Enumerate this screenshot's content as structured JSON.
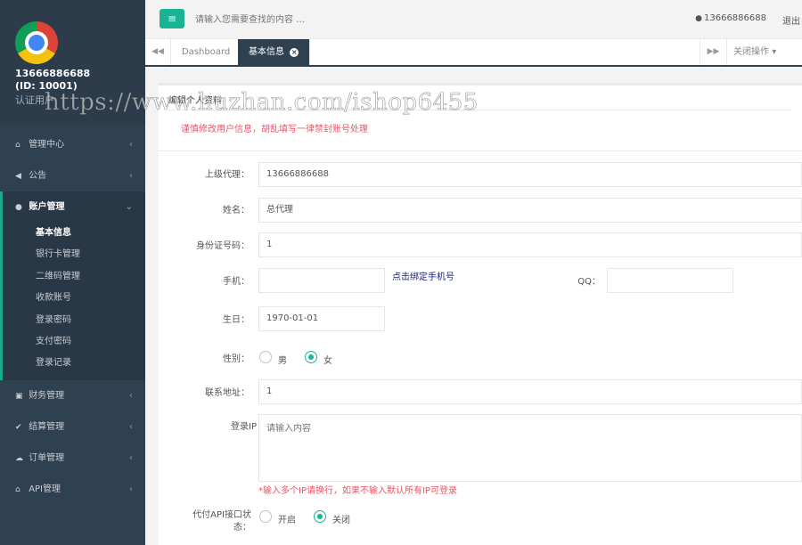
{
  "sidebar": {
    "profile": {
      "name": "13666886688",
      "id_line": "(ID:  10001)",
      "role": "认证用户"
    },
    "menu": [
      {
        "label": "管理中心",
        "icon": "home-icon"
      },
      {
        "label": "公告",
        "icon": "volume-icon"
      }
    ],
    "account": {
      "label": "账户管理",
      "icon": "user-icon",
      "items": [
        "基本信息",
        "银行卡管理",
        "二维码管理",
        "收款账号",
        "登录密码",
        "支付密码",
        "登录记录"
      ]
    },
    "menu_bottom": [
      {
        "label": "财务管理",
        "icon": "money-icon"
      },
      {
        "label": "结算管理",
        "icon": "check-icon"
      },
      {
        "label": "订单管理",
        "icon": "cloud-icon"
      },
      {
        "label": "API管理",
        "icon": "bank-icon"
      }
    ]
  },
  "topbar": {
    "search_placeholder": "请输入您需要查找的内容 …",
    "user": "13666886688",
    "logout": "退出"
  },
  "tabs": {
    "items": [
      {
        "label": "Dashboard"
      },
      {
        "label": "基本信息"
      }
    ],
    "close_ops": "关闭操作"
  },
  "panel": {
    "title": "编辑个人资料",
    "notice": "谨慎修改用户信息，胡乱填写一律禁封账号处理"
  },
  "form": {
    "parent_agent": {
      "label": "上级代理：",
      "value": "13666886688"
    },
    "name": {
      "label": "姓名：",
      "value": "总代理"
    },
    "id_number": {
      "label": "身份证号码：",
      "value": "1"
    },
    "phone": {
      "label": "手机：",
      "value": "",
      "bind_link": "点击绑定手机号"
    },
    "qq": {
      "label": "QQ：",
      "value": ""
    },
    "birthday": {
      "label": "生日：",
      "value": "1970-01-01"
    },
    "gender": {
      "label": "性别：",
      "options": [
        "男",
        "女"
      ],
      "selected": "女"
    },
    "address": {
      "label": "联系地址：",
      "value": "1"
    },
    "login_ip": {
      "label": "登录IP",
      "placeholder": "请输入内容",
      "hint": "*输入多个IP请换行，如果不输入默认所有IP可登录"
    },
    "api_status": {
      "label_line1": "代付API接口状",
      "label_line2": "态：",
      "options": [
        "开启",
        "关闭"
      ],
      "selected": "关闭"
    }
  },
  "watermark": "https://www.huzhan.com/ishop6455",
  "colors": {
    "accent": "#1ab394",
    "sidebar": "#2f4050",
    "warning": "#ed5565",
    "link": "#1a237e"
  }
}
